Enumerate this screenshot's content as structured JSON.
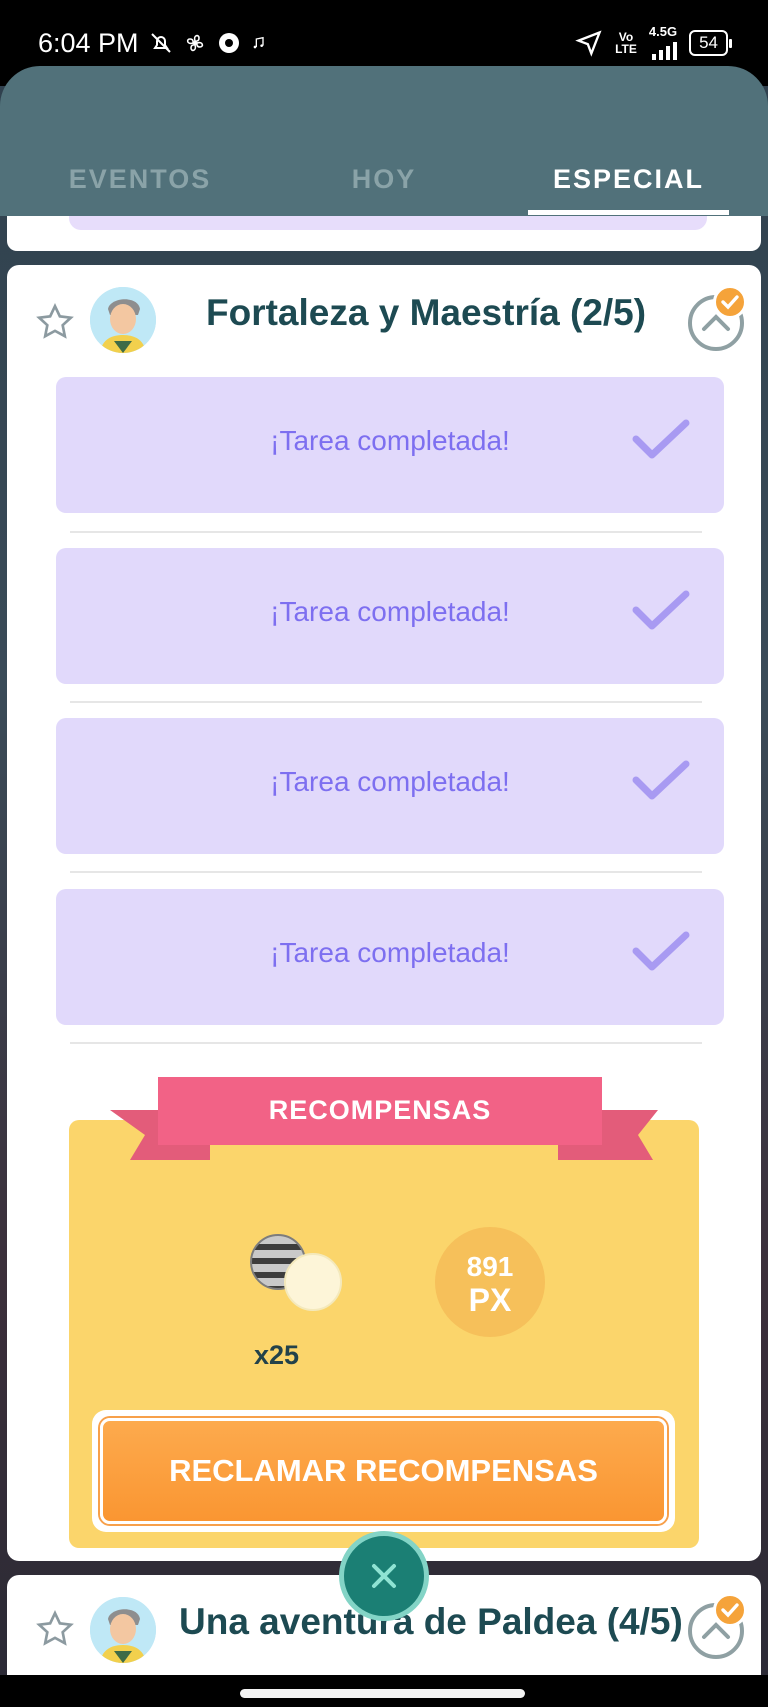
{
  "status_bar": {
    "time": "6:04 PM",
    "network_top": "Vo",
    "network_bottom": "LTE",
    "network_type": "4.5G",
    "battery": "54"
  },
  "tabs": [
    {
      "label": "EVENTOS",
      "active": false
    },
    {
      "label": "HOY",
      "active": false
    },
    {
      "label": "ESPECIAL",
      "active": true
    }
  ],
  "research_card": {
    "title": "Fortaleza y Maestría (2/5)",
    "tasks": [
      {
        "text": "¡Tarea completada!",
        "completed": true
      },
      {
        "text": "¡Tarea completada!",
        "completed": true
      },
      {
        "text": "¡Tarea completada!",
        "completed": true
      },
      {
        "text": "¡Tarea completada!",
        "completed": true
      }
    ],
    "rewards": {
      "banner": "RECOMPENSAS",
      "item_quantity": "x25",
      "xp_value": "891",
      "xp_unit": "PX",
      "claim_label": "RECLAMAR RECOMPENSAS"
    }
  },
  "next_card": {
    "title": "Una aventura de Paldea (4/5)"
  },
  "colors": {
    "header": "#51717a",
    "task_bg": "#e1d9fb",
    "task_text": "#7d6ff0",
    "reward_bg": "#fbd56b",
    "ribbon": "#f26286",
    "claim_button": "#fa9632",
    "title_text": "#1d4a52"
  },
  "icons": {
    "star": "star-icon",
    "check": "check-icon",
    "collapse": "chevron-up-icon",
    "close": "close-icon",
    "item": "ball-icon"
  }
}
